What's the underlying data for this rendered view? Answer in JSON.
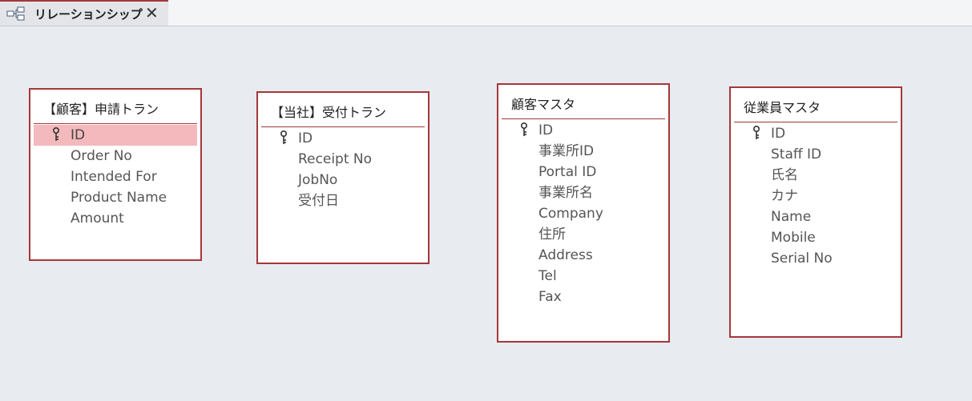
{
  "tab": {
    "icon": "relationships-icon",
    "label": "リレーションシップ",
    "close_icon": "close-icon",
    "close_glyph": "✕"
  },
  "tables": [
    {
      "title": "【顧客】申請トラン",
      "fields": [
        {
          "name": "ID",
          "primary_key": true,
          "selected": true
        },
        {
          "name": "Order No"
        },
        {
          "name": "Intended For"
        },
        {
          "name": "Product Name"
        },
        {
          "name": "Amount"
        }
      ]
    },
    {
      "title": "【当社】受付トラン",
      "fields": [
        {
          "name": "ID",
          "primary_key": true
        },
        {
          "name": "Receipt No"
        },
        {
          "name": "JobNo"
        },
        {
          "name": "受付日"
        }
      ]
    },
    {
      "title": "顧客マスタ",
      "fields": [
        {
          "name": "ID",
          "primary_key": true
        },
        {
          "name": "事業所ID"
        },
        {
          "name": "Portal ID"
        },
        {
          "name": "事業所名"
        },
        {
          "name": "Company"
        },
        {
          "name": "住所"
        },
        {
          "name": "Address"
        },
        {
          "name": "Tel"
        },
        {
          "name": "Fax"
        }
      ]
    },
    {
      "title": "従業員マスタ",
      "fields": [
        {
          "name": "ID",
          "primary_key": true
        },
        {
          "name": "Staff ID"
        },
        {
          "name": "氏名"
        },
        {
          "name": "カナ"
        },
        {
          "name": "Name"
        },
        {
          "name": "Mobile"
        },
        {
          "name": "Serial No"
        }
      ]
    }
  ],
  "colors": {
    "accent": "#a4373a",
    "selection": "#f4b9bd",
    "canvas": "#e8ebef"
  }
}
